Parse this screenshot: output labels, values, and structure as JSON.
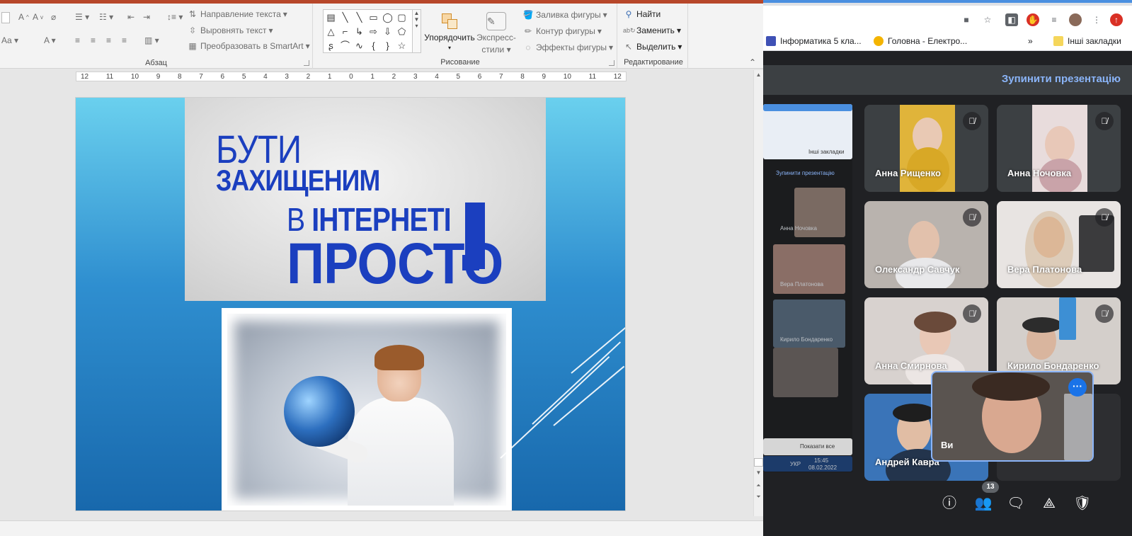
{
  "ribbon": {
    "paragraph": {
      "label": "Абзац",
      "text_direction": "Направление текста",
      "align_text": "Выровнять текст",
      "convert_smartart": "Преобразовать в SmartArt"
    },
    "drawing": {
      "label": "Рисование",
      "arrange": "Упорядочить",
      "quick_styles_line1": "Экспресс-",
      "quick_styles_line2": "стили",
      "shape_fill": "Заливка фигуры",
      "shape_outline": "Контур фигуры",
      "shape_effects": "Эффекты фигуры"
    },
    "editing": {
      "label": "Редактирование",
      "find": "Найти",
      "replace": "Заменить",
      "select": "Выделить"
    }
  },
  "ruler": {
    "ticks": [
      "12",
      "11",
      "10",
      "9",
      "8",
      "7",
      "6",
      "5",
      "4",
      "3",
      "2",
      "1",
      "0",
      "1",
      "2",
      "3",
      "4",
      "5",
      "6",
      "7",
      "8",
      "9",
      "10",
      "11",
      "12"
    ]
  },
  "slide": {
    "title_line1": "БУТИ",
    "title_line2": "ЗАХИЩЕНИМ",
    "title_line3_prefix": "В",
    "title_line3_bold": "ІНТЕРНЕТІ",
    "title_line4": "ПРОСТО"
  },
  "chrome": {
    "bookmarks": [
      {
        "label": "Інформатика 5 кла...",
        "color": "#3f51b5"
      },
      {
        "label": "Головна - Електро...",
        "color": "#f4b400"
      }
    ],
    "more_bookmarks_chevron": "»",
    "other_bookmarks": "Інші закладки"
  },
  "meet": {
    "stop_presenting": "Зупинити презентацію",
    "participants": [
      {
        "name": "Анна Рищенко",
        "bg": "#e8b931"
      },
      {
        "name": "Анна Ночовка",
        "bg": "#d9c6c4"
      },
      {
        "name": "Олександр Савчук",
        "bg": "#c9c4bf"
      },
      {
        "name": "Вера Платонова",
        "bg": "#e8e4e2"
      },
      {
        "name": "Анна Смирнова",
        "bg": "#d8d2cf"
      },
      {
        "name": "Кирило Бондаренко",
        "bg": "#d4cfcb"
      },
      {
        "name": "Андрей Кавра",
        "bg": "#3a74b8"
      }
    ],
    "self_name": "Ви",
    "people_count": "13",
    "preview": {
      "stop_text": "Зупинити презентацію",
      "tile1": "Анна Ночовка",
      "tile2": "Вера Платонова",
      "tile3": "Кирило Бондаренко",
      "show_all": "Показати все",
      "taskbar_lang": "УКР",
      "taskbar_time": "15:45",
      "taskbar_date": "08.02.2022",
      "other_bookmarks": "Інші закладки"
    }
  }
}
